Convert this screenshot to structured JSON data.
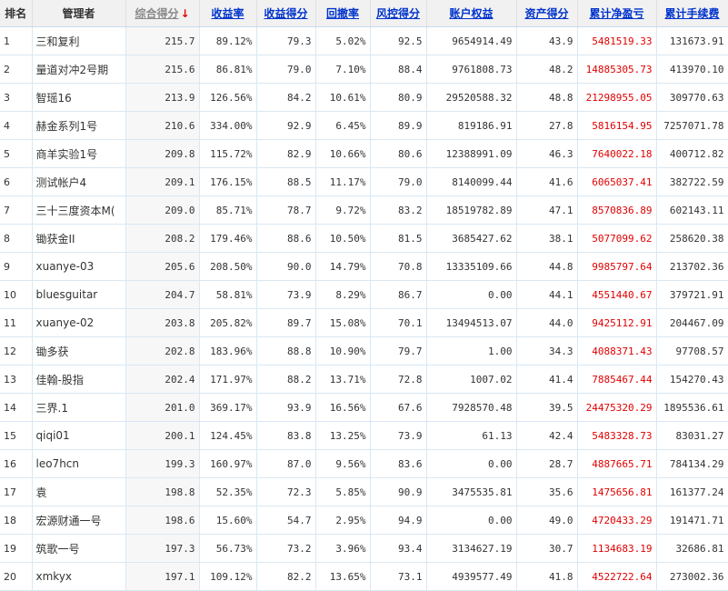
{
  "headers": {
    "rank": "排名",
    "manager": "管理者",
    "composite": "综合得分",
    "return_rate": "收益率",
    "return_score": "收益得分",
    "drawdown": "回撤率",
    "risk_score": "风控得分",
    "equity": "账户权益",
    "asset_score": "资产得分",
    "net_pnl": "累计净盈亏",
    "fees": "累计手续费"
  },
  "sort_indicator": "↓",
  "colors": {
    "link": "#0033cc",
    "pnl": "#e00000",
    "grid": "#d9e8f4"
  },
  "rows": [
    {
      "rank": "1",
      "name": "三和复利",
      "composite": "215.7",
      "return_rate": "89.12%",
      "return_score": "79.3",
      "drawdown": "5.02%",
      "risk_score": "92.5",
      "equity": "9654914.49",
      "asset_score": "43.9",
      "net_pnl": "5481519.33",
      "fees": "131673.91"
    },
    {
      "rank": "2",
      "name": "量道对冲2号期",
      "composite": "215.6",
      "return_rate": "86.81%",
      "return_score": "79.0",
      "drawdown": "7.10%",
      "risk_score": "88.4",
      "equity": "9761808.73",
      "asset_score": "48.2",
      "net_pnl": "14885305.73",
      "fees": "413970.10"
    },
    {
      "rank": "3",
      "name": "智瑶16",
      "composite": "213.9",
      "return_rate": "126.56%",
      "return_score": "84.2",
      "drawdown": "10.61%",
      "risk_score": "80.9",
      "equity": "29520588.32",
      "asset_score": "48.8",
      "net_pnl": "21298955.05",
      "fees": "309770.63"
    },
    {
      "rank": "4",
      "name": "赫金系列1号",
      "composite": "210.6",
      "return_rate": "334.00%",
      "return_score": "92.9",
      "drawdown": "6.45%",
      "risk_score": "89.9",
      "equity": "819186.91",
      "asset_score": "27.8",
      "net_pnl": "5816154.95",
      "fees": "7257071.78"
    },
    {
      "rank": "5",
      "name": "商羊实验1号",
      "composite": "209.8",
      "return_rate": "115.72%",
      "return_score": "82.9",
      "drawdown": "10.66%",
      "risk_score": "80.6",
      "equity": "12388991.09",
      "asset_score": "46.3",
      "net_pnl": "7640022.18",
      "fees": "400712.82"
    },
    {
      "rank": "6",
      "name": "测试帐户4",
      "composite": "209.1",
      "return_rate": "176.15%",
      "return_score": "88.5",
      "drawdown": "11.17%",
      "risk_score": "79.0",
      "equity": "8140099.44",
      "asset_score": "41.6",
      "net_pnl": "6065037.41",
      "fees": "382722.59"
    },
    {
      "rank": "7",
      "name": "三十三度资本M(",
      "composite": "209.0",
      "return_rate": "85.71%",
      "return_score": "78.7",
      "drawdown": "9.72%",
      "risk_score": "83.2",
      "equity": "18519782.89",
      "asset_score": "47.1",
      "net_pnl": "8570836.89",
      "fees": "602143.11"
    },
    {
      "rank": "8",
      "name": "锄获金II",
      "composite": "208.2",
      "return_rate": "179.46%",
      "return_score": "88.6",
      "drawdown": "10.50%",
      "risk_score": "81.5",
      "equity": "3685427.62",
      "asset_score": "38.1",
      "net_pnl": "5077099.62",
      "fees": "258620.38"
    },
    {
      "rank": "9",
      "name": "xuanye-03",
      "composite": "205.6",
      "return_rate": "208.50%",
      "return_score": "90.0",
      "drawdown": "14.79%",
      "risk_score": "70.8",
      "equity": "13335109.66",
      "asset_score": "44.8",
      "net_pnl": "9985797.64",
      "fees": "213702.36"
    },
    {
      "rank": "10",
      "name": "bluesguitar",
      "composite": "204.7",
      "return_rate": "58.81%",
      "return_score": "73.9",
      "drawdown": "8.29%",
      "risk_score": "86.7",
      "equity": "0.00",
      "asset_score": "44.1",
      "net_pnl": "4551440.67",
      "fees": "379721.91"
    },
    {
      "rank": "11",
      "name": "xuanye-02",
      "composite": "203.8",
      "return_rate": "205.82%",
      "return_score": "89.7",
      "drawdown": "15.08%",
      "risk_score": "70.1",
      "equity": "13494513.07",
      "asset_score": "44.0",
      "net_pnl": "9425112.91",
      "fees": "204467.09"
    },
    {
      "rank": "12",
      "name": "锄多获",
      "composite": "202.8",
      "return_rate": "183.96%",
      "return_score": "88.8",
      "drawdown": "10.90%",
      "risk_score": "79.7",
      "equity": "1.00",
      "asset_score": "34.3",
      "net_pnl": "4088371.43",
      "fees": "97708.57"
    },
    {
      "rank": "13",
      "name": "佳翰-股指",
      "composite": "202.4",
      "return_rate": "171.97%",
      "return_score": "88.2",
      "drawdown": "13.71%",
      "risk_score": "72.8",
      "equity": "1007.02",
      "asset_score": "41.4",
      "net_pnl": "7885467.44",
      "fees": "154270.43"
    },
    {
      "rank": "14",
      "name": "三界.1",
      "composite": "201.0",
      "return_rate": "369.17%",
      "return_score": "93.9",
      "drawdown": "16.56%",
      "risk_score": "67.6",
      "equity": "7928570.48",
      "asset_score": "39.5",
      "net_pnl": "24475320.29",
      "fees": "1895536.61"
    },
    {
      "rank": "15",
      "name": "qiqi01",
      "composite": "200.1",
      "return_rate": "124.45%",
      "return_score": "83.8",
      "drawdown": "13.25%",
      "risk_score": "73.9",
      "equity": "61.13",
      "asset_score": "42.4",
      "net_pnl": "5483328.73",
      "fees": "83031.27"
    },
    {
      "rank": "16",
      "name": "leo7hcn",
      "composite": "199.3",
      "return_rate": "160.97%",
      "return_score": "87.0",
      "drawdown": "9.56%",
      "risk_score": "83.6",
      "equity": "0.00",
      "asset_score": "28.7",
      "net_pnl": "4887665.71",
      "fees": "784134.29"
    },
    {
      "rank": "17",
      "name": "袁",
      "composite": "198.8",
      "return_rate": "52.35%",
      "return_score": "72.3",
      "drawdown": "5.85%",
      "risk_score": "90.9",
      "equity": "3475535.81",
      "asset_score": "35.6",
      "net_pnl": "1475656.81",
      "fees": "161377.24"
    },
    {
      "rank": "18",
      "name": "宏源财通一号",
      "composite": "198.6",
      "return_rate": "15.60%",
      "return_score": "54.7",
      "drawdown": "2.95%",
      "risk_score": "94.9",
      "equity": "0.00",
      "asset_score": "49.0",
      "net_pnl": "4720433.29",
      "fees": "191471.71"
    },
    {
      "rank": "19",
      "name": "筑歌一号",
      "composite": "197.3",
      "return_rate": "56.73%",
      "return_score": "73.2",
      "drawdown": "3.96%",
      "risk_score": "93.4",
      "equity": "3134627.19",
      "asset_score": "30.7",
      "net_pnl": "1134683.19",
      "fees": "32686.81"
    },
    {
      "rank": "20",
      "name": "xmkyx",
      "composite": "197.1",
      "return_rate": "109.12%",
      "return_score": "82.2",
      "drawdown": "13.65%",
      "risk_score": "73.1",
      "equity": "4939577.49",
      "asset_score": "41.8",
      "net_pnl": "4522722.64",
      "fees": "273002.36"
    }
  ]
}
